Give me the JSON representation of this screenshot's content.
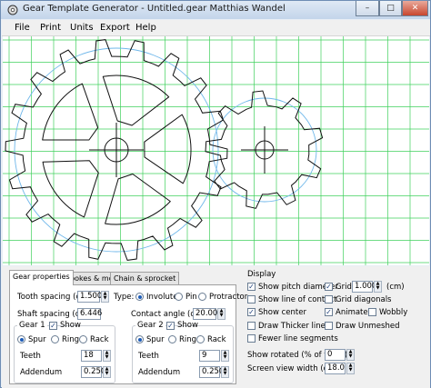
{
  "window": {
    "title": "Gear Template Generator - Untitled.gear     Matthias Wandel",
    "controls": [
      "–",
      "□",
      "✕"
    ]
  },
  "menu": [
    "File",
    "Print",
    "Units",
    "Export",
    "Help"
  ],
  "tabs": [
    "Gear properties",
    "Spokes & more",
    "Chain & sprocket"
  ],
  "gear_props": {
    "tooth_spacing_label": "Tooth spacing (cm)",
    "tooth_spacing": "1.500",
    "type_label": "Type:",
    "type_options": [
      "Involute",
      "Pin",
      "Protractor"
    ],
    "shaft_spacing_label": "Shaft spacing (cm)",
    "shaft_spacing": "6.446",
    "contact_angle_label": "Contact angle (deg)",
    "contact_angle": "20.00",
    "gear1": {
      "title": "Gear 1",
      "show_label": "Show",
      "kinds": [
        "Spur",
        "Ring",
        "Rack"
      ],
      "teeth_label": "Teeth",
      "teeth": "18",
      "addendum_label": "Addendum",
      "addendum": "0.250"
    },
    "gear2": {
      "title": "Gear 2",
      "show_label": "Show",
      "kinds": [
        "Spur",
        "Ring",
        "Rack"
      ],
      "teeth_label": "Teeth",
      "teeth": "9",
      "addendum_label": "Addendum",
      "addendum": "0.250"
    }
  },
  "display": {
    "title": "Display",
    "show_pitch_diameter": "Show pitch diameter",
    "grid": "Grid",
    "grid_value": "1.000",
    "grid_unit": "(cm)",
    "show_line_of_contact": "Show line of contact",
    "grid_diagonals": "Grid diagonals",
    "show_center": "Show center",
    "animate": "Animate",
    "wobbly": "Wobbly",
    "draw_thicker_lines": "Draw Thicker lines",
    "draw_unmeshed": "Draw Unmeshed",
    "fewer_line_segments": "Fewer line segments",
    "show_rotated_label": "Show rotated (% of tooth)",
    "show_rotated": "0",
    "screen_view_width_label": "Screen view width (cm)",
    "screen_view_width": "18.0"
  },
  "colors": {
    "grid": "#3fd15c",
    "pitch": "#6fb7ea",
    "gear": "#111111"
  }
}
